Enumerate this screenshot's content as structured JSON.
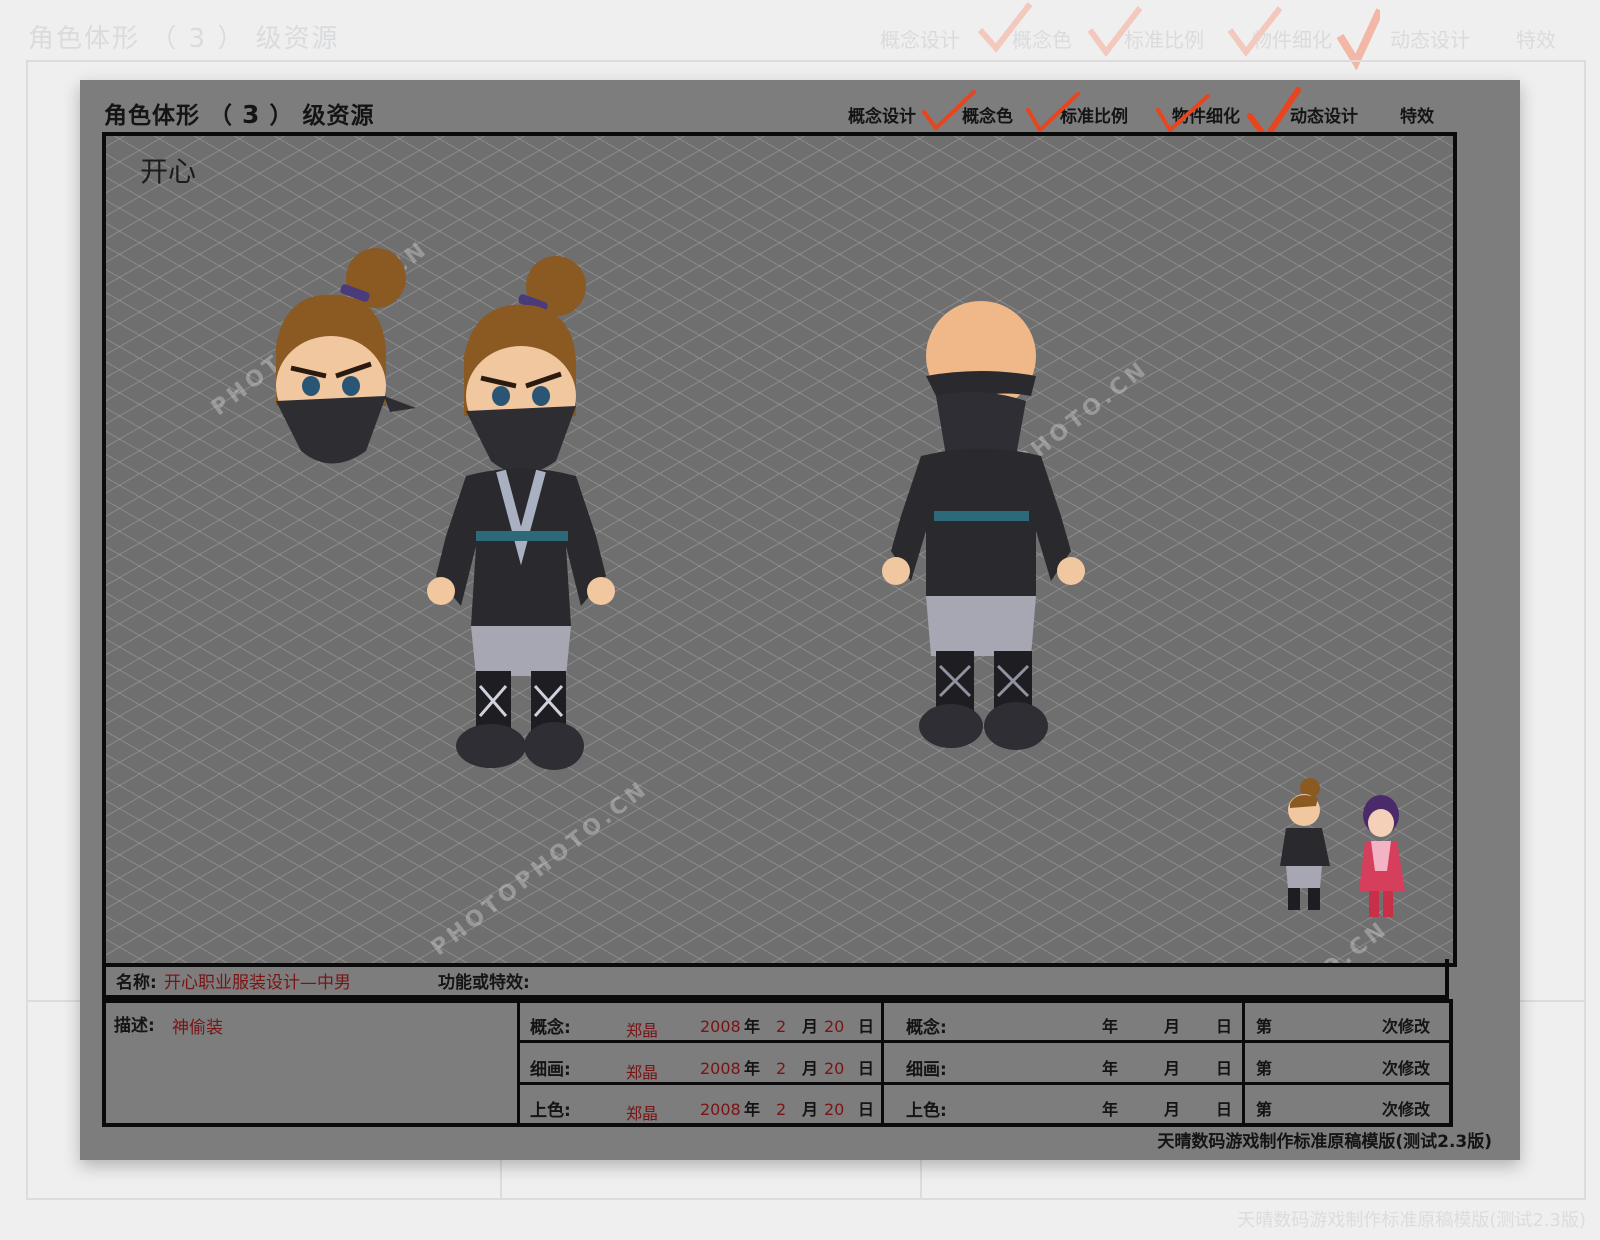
{
  "background_sheet": {
    "title": "角色体形 （ 3 ） 级资源",
    "stages": [
      "概念设计",
      "概念色",
      "标准比例",
      "物件细化",
      "动态设计",
      "特效"
    ],
    "footer": "天晴数码游戏制作标准原稿模版(测试2.3版)"
  },
  "sheet": {
    "title_prefix": "角色体形 （",
    "title_num": "3",
    "title_suffix": "） 级资源",
    "stages": [
      {
        "label": "概念设计",
        "checked": true
      },
      {
        "label": "概念色",
        "checked": true
      },
      {
        "label": "标准比例",
        "checked": true
      },
      {
        "label": "物件细化",
        "checked": true
      },
      {
        "label": "动态设计",
        "checked": false
      },
      {
        "label": "特效",
        "checked": false
      }
    ],
    "character_name": "开心",
    "watermark_text": "PHOTOPHOTO.CN",
    "name_label": "名称:",
    "name_value": "开心职业服装设计—中男",
    "function_label": "功能或特效:",
    "desc_label": "描述:",
    "desc_value": "神偷装",
    "records_left": [
      {
        "label": "概念:",
        "author": "郑晶",
        "year": "2008",
        "month": "2",
        "day": "20"
      },
      {
        "label": "细画:",
        "author": "郑晶",
        "year": "2008",
        "month": "2",
        "day": "20"
      },
      {
        "label": "上色:",
        "author": "郑晶",
        "year": "2008",
        "month": "2",
        "day": "20"
      }
    ],
    "records_right": [
      {
        "label": "概念:"
      },
      {
        "label": "细画:"
      },
      {
        "label": "上色:"
      }
    ],
    "unit_year": "年",
    "unit_month": "月",
    "unit_day": "日",
    "rev_prefix": "第",
    "rev_suffix": "次修改",
    "footer": "天晴数码游戏制作标准原稿模版(测试2.3版)"
  },
  "colors": {
    "check": "#e8451e",
    "check_light": "#f7c3b6",
    "value_red": "#7a1414"
  }
}
